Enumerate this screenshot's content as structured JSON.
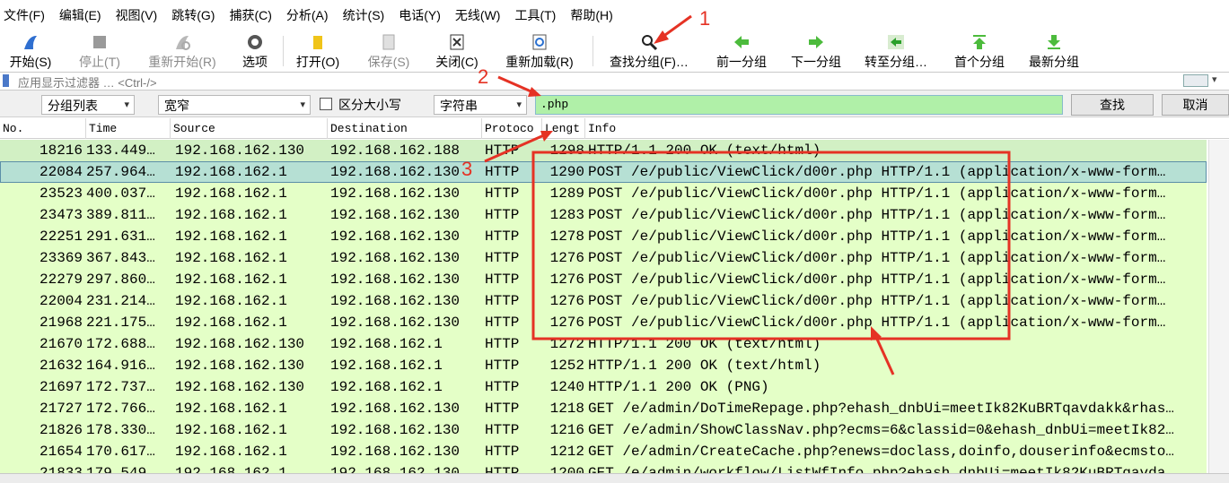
{
  "menu": [
    "文件(F)",
    "编辑(E)",
    "视图(V)",
    "跳转(G)",
    "捕获(C)",
    "分析(A)",
    "统计(S)",
    "电话(Y)",
    "无线(W)",
    "工具(T)",
    "帮助(H)"
  ],
  "toolbar": {
    "start": "开始(S)",
    "stop": "停止(T)",
    "restart": "重新开始(R)",
    "options": "选项",
    "open": "打开(O)",
    "save": "保存(S)",
    "close": "关闭(C)",
    "reload": "重新加载(R)",
    "find": "查找分组(F)…",
    "prev": "前一分组",
    "next": "下一分组",
    "goto": "转至分组…",
    "first": "首个分组",
    "last": "最新分组"
  },
  "filter": {
    "placeholder": "应用显示过滤器 … <Ctrl-/>"
  },
  "find": {
    "scope": "分组列表",
    "width": "宽窄",
    "case_label": "区分大小写",
    "type": "字符串",
    "query": ".php",
    "find_btn": "查找",
    "cancel_btn": "取消"
  },
  "columns": [
    "No.",
    "Time",
    "Source",
    "Destination",
    "Protoco",
    "Lengt",
    "Info"
  ],
  "rows": [
    {
      "no": "18216",
      "time": "133.449…",
      "src": "192.168.162.130",
      "dst": "192.168.162.188",
      "proto": "HTTP",
      "len": "1298",
      "info": "HTTP/1.1 200 OK  (text/html)",
      "state": "hl"
    },
    {
      "no": "22084",
      "time": "257.964…",
      "src": "192.168.162.1",
      "dst": "192.168.162.130",
      "proto": "HTTP",
      "len": "1290",
      "info": "POST /e/public/ViewClick/d00r.php HTTP/1.1  (application/x-www-form…",
      "state": "sel"
    },
    {
      "no": "23523",
      "time": "400.037…",
      "src": "192.168.162.1",
      "dst": "192.168.162.130",
      "proto": "HTTP",
      "len": "1289",
      "info": "POST /e/public/ViewClick/d00r.php HTTP/1.1  (application/x-www-form…",
      "state": ""
    },
    {
      "no": "23473",
      "time": "389.811…",
      "src": "192.168.162.1",
      "dst": "192.168.162.130",
      "proto": "HTTP",
      "len": "1283",
      "info": "POST /e/public/ViewClick/d00r.php HTTP/1.1  (application/x-www-form…",
      "state": ""
    },
    {
      "no": "22251",
      "time": "291.631…",
      "src": "192.168.162.1",
      "dst": "192.168.162.130",
      "proto": "HTTP",
      "len": "1278",
      "info": "POST /e/public/ViewClick/d00r.php HTTP/1.1  (application/x-www-form…",
      "state": ""
    },
    {
      "no": "23369",
      "time": "367.843…",
      "src": "192.168.162.1",
      "dst": "192.168.162.130",
      "proto": "HTTP",
      "len": "1276",
      "info": "POST /e/public/ViewClick/d00r.php HTTP/1.1  (application/x-www-form…",
      "state": ""
    },
    {
      "no": "22279",
      "time": "297.860…",
      "src": "192.168.162.1",
      "dst": "192.168.162.130",
      "proto": "HTTP",
      "len": "1276",
      "info": "POST /e/public/ViewClick/d00r.php HTTP/1.1  (application/x-www-form…",
      "state": ""
    },
    {
      "no": "22004",
      "time": "231.214…",
      "src": "192.168.162.1",
      "dst": "192.168.162.130",
      "proto": "HTTP",
      "len": "1276",
      "info": "POST /e/public/ViewClick/d00r.php HTTP/1.1  (application/x-www-form…",
      "state": ""
    },
    {
      "no": "21968",
      "time": "221.175…",
      "src": "192.168.162.1",
      "dst": "192.168.162.130",
      "proto": "HTTP",
      "len": "1276",
      "info": "POST /e/public/ViewClick/d00r.php HTTP/1.1  (application/x-www-form…",
      "state": ""
    },
    {
      "no": "21670",
      "time": "172.688…",
      "src": "192.168.162.130",
      "dst": "192.168.162.1",
      "proto": "HTTP",
      "len": "1272",
      "info": "HTTP/1.1 200 OK  (text/html)",
      "state": ""
    },
    {
      "no": "21632",
      "time": "164.916…",
      "src": "192.168.162.130",
      "dst": "192.168.162.1",
      "proto": "HTTP",
      "len": "1252",
      "info": "HTTP/1.1 200 OK  (text/html)",
      "state": ""
    },
    {
      "no": "21697",
      "time": "172.737…",
      "src": "192.168.162.130",
      "dst": "192.168.162.1",
      "proto": "HTTP",
      "len": "1240",
      "info": "HTTP/1.1 200 OK  (PNG)",
      "state": ""
    },
    {
      "no": "21727",
      "time": "172.766…",
      "src": "192.168.162.1",
      "dst": "192.168.162.130",
      "proto": "HTTP",
      "len": "1218",
      "info": "GET /e/admin/DoTimeRepage.php?ehash_dnbUi=meetIk82KuBRTqavdakk&rhas…",
      "state": ""
    },
    {
      "no": "21826",
      "time": "178.330…",
      "src": "192.168.162.1",
      "dst": "192.168.162.130",
      "proto": "HTTP",
      "len": "1216",
      "info": "GET /e/admin/ShowClassNav.php?ecms=6&classid=0&ehash_dnbUi=meetIk82…",
      "state": ""
    },
    {
      "no": "21654",
      "time": "170.617…",
      "src": "192.168.162.1",
      "dst": "192.168.162.130",
      "proto": "HTTP",
      "len": "1212",
      "info": "GET /e/admin/CreateCache.php?enews=doclass,doinfo,douserinfo&ecmsto…",
      "state": ""
    },
    {
      "no": "21833",
      "time": "179.549…",
      "src": "192.168.162.1",
      "dst": "192.168.162.130",
      "proto": "HTTP",
      "len": "1200",
      "info": "GET /e/admin/workflow/ListWfInfo.php?ehash_dnbUi=meetIk82KuBRTqavda…",
      "state": ""
    }
  ],
  "annotations": {
    "n1": "1",
    "n2": "2",
    "n3": "3"
  },
  "colors": {
    "row_bg": "#e4ffc7",
    "selected_bg": "#b6e0d4",
    "find_input_bg": "#b0f0a8",
    "annotation": "#e53224"
  }
}
